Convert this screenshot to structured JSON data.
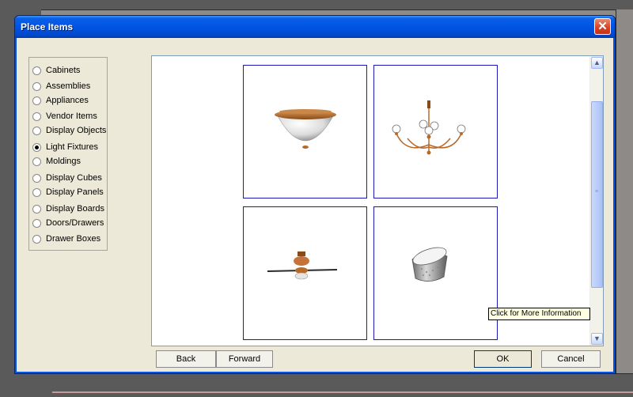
{
  "dialog": {
    "title": "Place Items"
  },
  "categories": [
    {
      "label": "Cabinets",
      "selected": false
    },
    {
      "label": "Assemblies",
      "selected": false
    },
    {
      "label": "Appliances",
      "selected": false
    },
    {
      "label": "Vendor Items",
      "selected": false
    },
    {
      "label": "Display Objects",
      "selected": false
    },
    {
      "label": "Light Fixtures",
      "selected": true
    },
    {
      "label": "Moldings",
      "selected": false
    },
    {
      "label": "Display Cubes",
      "selected": false
    },
    {
      "label": "Display Panels",
      "selected": false
    },
    {
      "label": "Display Boards",
      "selected": false
    },
    {
      "label": "Doors/Drawers",
      "selected": false
    },
    {
      "label": "Drawer Boxes",
      "selected": false
    }
  ],
  "items": [
    {
      "icon": "ceiling-dome-light-icon"
    },
    {
      "icon": "chandelier-icon"
    },
    {
      "icon": "ceiling-fan-icon"
    },
    {
      "icon": "cylinder-pendant-icon"
    }
  ],
  "tooltip": "Click for More Information",
  "buttons": {
    "back": "Back",
    "forward": "Forward",
    "ok": "OK",
    "cancel": "Cancel"
  },
  "close_glyph": "✕",
  "colors": {
    "title_bar": "#0054e3",
    "tile_border": "#1a1ab8",
    "fixture_copper": "#b86a2a"
  }
}
